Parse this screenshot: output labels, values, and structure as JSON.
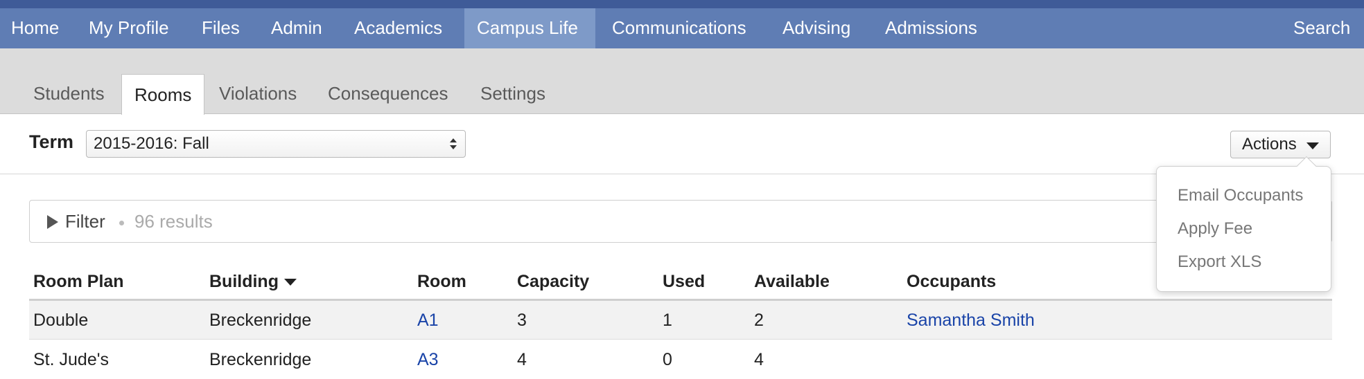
{
  "topnav": {
    "items": [
      {
        "label": "Home"
      },
      {
        "label": "My Profile"
      },
      {
        "label": "Files"
      },
      {
        "label": "Admin"
      },
      {
        "label": "Academics"
      },
      {
        "label": "Campus Life",
        "active": true
      },
      {
        "label": "Communications"
      },
      {
        "label": "Advising"
      },
      {
        "label": "Admissions"
      }
    ],
    "search_label": "Search"
  },
  "subnav": {
    "tabs": [
      {
        "label": "Students"
      },
      {
        "label": "Rooms",
        "active": true
      },
      {
        "label": "Violations"
      },
      {
        "label": "Consequences"
      },
      {
        "label": "Settings"
      }
    ]
  },
  "term": {
    "label": "Term",
    "selected": "2015-2016: Fall"
  },
  "actions": {
    "label": "Actions",
    "menu": [
      "Email Occupants",
      "Apply Fee",
      "Export XLS"
    ]
  },
  "filter": {
    "label": "Filter",
    "results": "96 results"
  },
  "table": {
    "columns": [
      "Room Plan",
      "Building",
      "Room",
      "Capacity",
      "Used",
      "Available",
      "Occupants"
    ],
    "sorted_column": "Building",
    "rows": [
      {
        "room_plan": "Double",
        "building": "Breckenridge",
        "room": "A1",
        "capacity": "3",
        "used": "1",
        "available": "2",
        "occupants": "Samantha Smith"
      },
      {
        "room_plan": "St. Jude's",
        "building": "Breckenridge",
        "room": "A3",
        "capacity": "4",
        "used": "0",
        "available": "4",
        "occupants": ""
      }
    ]
  },
  "colors": {
    "nav_bg": "#5f7db4",
    "nav_active": "#7e9ac8",
    "nav_accent": "#3f5b98",
    "link": "#1a44a8"
  }
}
